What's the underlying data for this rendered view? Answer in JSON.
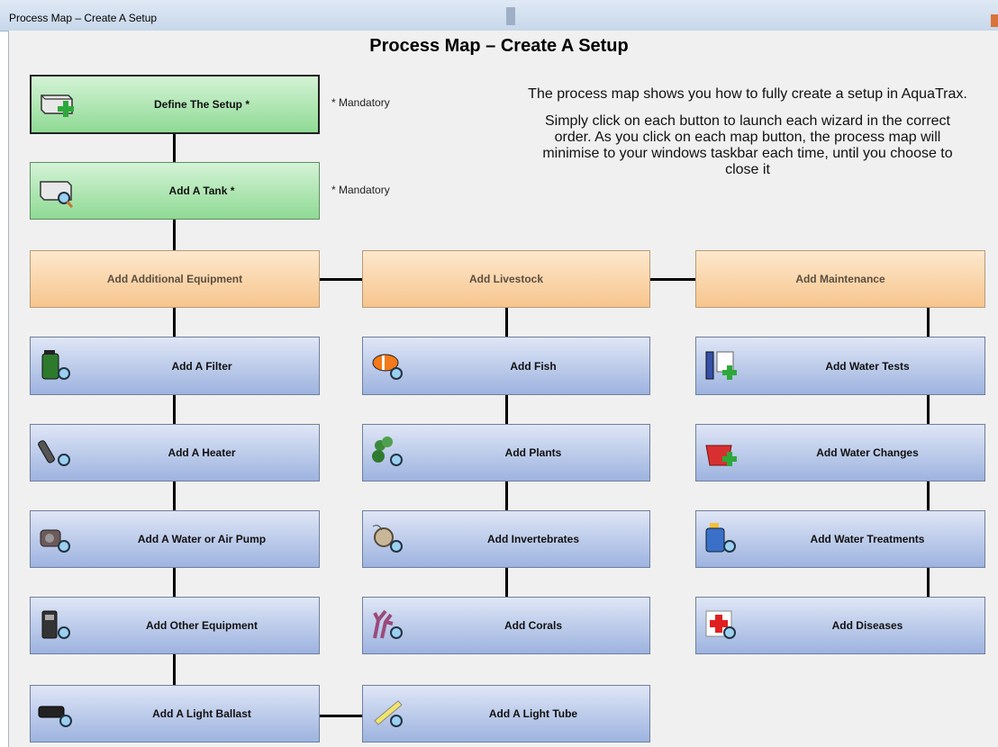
{
  "window": {
    "title": "Process Map – Create A Setup"
  },
  "heading": "Process Map – Create A Setup",
  "info": {
    "p1": "The process map shows you how to fully create a setup in AquaTrax.",
    "p2": "Simply click on each button to launch each wizard in the correct order. As you click on each map button, the process map will minimise to your windows taskbar each time, until you choose to close it"
  },
  "mandatory_note": "* Mandatory",
  "setup": {
    "define": {
      "label": "Define The Setup *",
      "icon": "tank-add-icon"
    },
    "tank": {
      "label": "Add A Tank *",
      "icon": "tank-search-icon"
    }
  },
  "categories": {
    "equipment": "Add Additional Equipment",
    "livestock": "Add Livestock",
    "maintenance": "Add Maintenance"
  },
  "equipment": [
    {
      "label": "Add A Filter",
      "icon": "filter-icon"
    },
    {
      "label": "Add A Heater",
      "icon": "heater-icon"
    },
    {
      "label": "Add A Water or Air Pump",
      "icon": "pump-icon"
    },
    {
      "label": "Add Other Equipment",
      "icon": "equipment-icon"
    },
    {
      "label": "Add A Light Ballast",
      "icon": "ballast-icon"
    }
  ],
  "livestock": [
    {
      "label": "Add Fish",
      "icon": "fish-icon"
    },
    {
      "label": "Add Plants",
      "icon": "plant-icon"
    },
    {
      "label": "Add Invertebrates",
      "icon": "snail-icon"
    },
    {
      "label": "Add Corals",
      "icon": "coral-icon"
    },
    {
      "label": "Add A Light Tube",
      "icon": "light-tube-icon"
    }
  ],
  "maintenance": [
    {
      "label": "Add Water Tests",
      "icon": "water-test-icon"
    },
    {
      "label": "Add Water Changes",
      "icon": "bucket-icon"
    },
    {
      "label": "Add Water Treatments",
      "icon": "treatment-bottle-icon"
    },
    {
      "label": "Add Diseases",
      "icon": "medical-cross-icon"
    }
  ],
  "colors": {
    "green": "#8fda94",
    "orange": "#f7c58d",
    "blue": "#9db3df"
  }
}
